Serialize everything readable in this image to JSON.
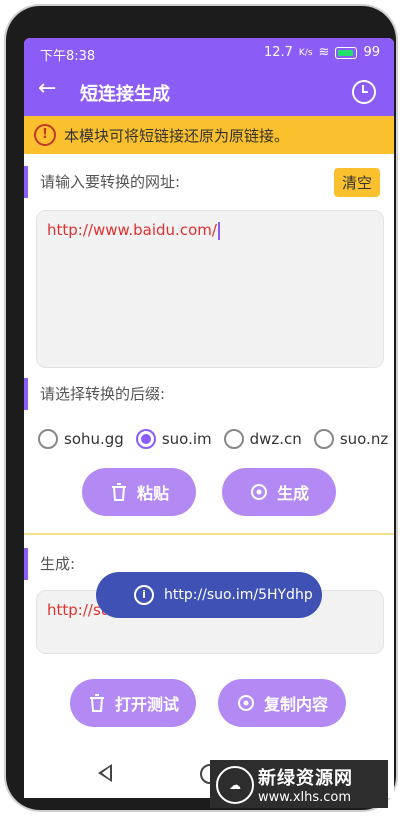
{
  "status_bar": {
    "time": "下午8:38",
    "network_speed": "12.7",
    "network_unit": "K/s",
    "battery": "99"
  },
  "app_bar": {
    "title": "短连接生成",
    "back_icon": "arrow-left-icon",
    "history_icon": "clock-icon"
  },
  "notice": {
    "text": "本模块可将短链接还原为原链接。",
    "icon": "alert-circle-icon"
  },
  "input_section": {
    "label": "请输入要转换的网址:",
    "clear_label": "清空",
    "value": "http://www.baidu.com/"
  },
  "suffix_section": {
    "label": "请选择转换的后缀:",
    "options": [
      "sohu.gg",
      "suo.im",
      "dwz.cn",
      "suo.nz"
    ],
    "selected": "suo.im"
  },
  "actions": {
    "paste_label": "粘贴",
    "generate_label": "生成"
  },
  "result_section": {
    "label": "生成:",
    "value": "http://suo.im/5HYdhp"
  },
  "toast": {
    "text": "http://suo.im/5HYdhp"
  },
  "bottom_actions": {
    "open_test_label": "打开测试",
    "copy_label": "复制内容"
  },
  "watermark": {
    "title": "新绿资源网",
    "url": "www.xlhs.com"
  },
  "colors": {
    "primary": "#8b5cf6",
    "button": "#b38af4",
    "notice": "#fbc02d",
    "toast": "#3f51b5",
    "link": "#e03131"
  }
}
